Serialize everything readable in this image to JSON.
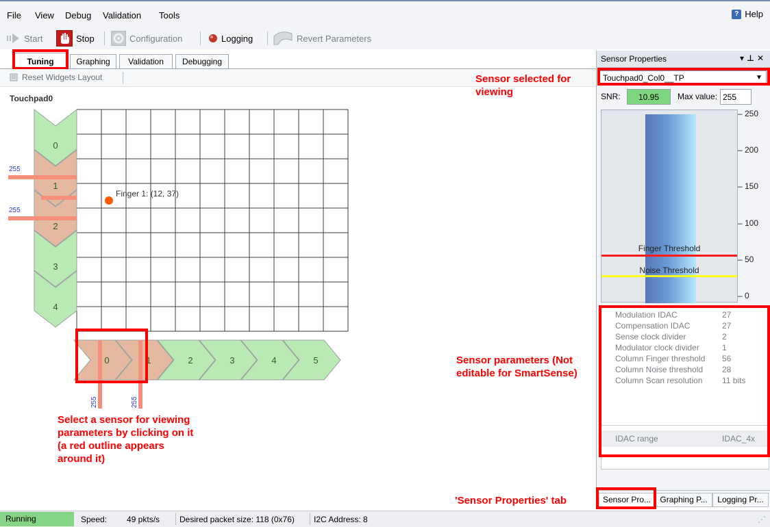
{
  "menu": {
    "items": [
      "File",
      "View",
      "Debug",
      "Validation",
      "Tools"
    ],
    "help": "Help",
    "help_icon": "help-book-icon"
  },
  "toolbar": {
    "start": "Start",
    "stop": "Stop",
    "configuration": "Configuration",
    "logging": "Logging",
    "revert": "Revert Parameters"
  },
  "tabs": [
    "Tuning",
    "Graphing",
    "Validation",
    "Debugging"
  ],
  "active_tab": "Tuning",
  "widgets": {
    "reset_label": "Reset Widgets Layout",
    "widget_title": "Touchpad0"
  },
  "touchpad": {
    "rows": [
      "0",
      "1",
      "2",
      "3",
      "4"
    ],
    "columns": [
      "0",
      "1",
      "2",
      "3",
      "4",
      "5"
    ],
    "finger_label": "Finger 1: (12, 37)",
    "row_values": [
      "255",
      "255"
    ],
    "col_values": [
      "255",
      "255"
    ],
    "colors": {
      "active_sensor": "#e4b9a0",
      "idle_sensor": "#b9eab4",
      "finger": "#ff5a00",
      "signal_bar": "#f58f7c",
      "value_text": "#2a3bd8"
    }
  },
  "annotations": {
    "sensor_selected": "Sensor selected for\nviewing",
    "select_sensor": "Select a sensor for viewing\nparameters by clicking on it\n(a red outline appears\naround it)",
    "sensor_params": "Sensor parameters (Not\neditable for SmartSense)",
    "props_tab": "'Sensor Properties' tab",
    "color": "#ff0000"
  },
  "panel": {
    "title": "Sensor Properties",
    "controls": "▾ ⊓ ✕",
    "selected_sensor": "Touchpad0_Col0__TP",
    "snr_label": "SNR:",
    "snr_value": "10.95",
    "max_label": "Max value:",
    "max_value": "255",
    "bar_level": 1.0,
    "finger_threshold_label": "Finger Threshold",
    "finger_threshold_value": 56,
    "noise_threshold_label": "Noise Threshold",
    "noise_threshold_value": 28,
    "scale": [
      "250",
      "200",
      "150",
      "100",
      "50",
      "0"
    ],
    "properties": [
      {
        "name": "Modulation IDAC",
        "value": "27"
      },
      {
        "name": "Compensation IDAC",
        "value": "27"
      },
      {
        "name": "Sense clock divider",
        "value": "2"
      },
      {
        "name": "Modulator clock divider",
        "value": "1"
      },
      {
        "name": "Column Finger threshold",
        "value": "56"
      },
      {
        "name": "Column Noise threshold",
        "value": "28"
      },
      {
        "name": "Column Scan resolution",
        "value": "11 bits"
      }
    ],
    "idac": {
      "name": "IDAC range",
      "value": "IDAC_4x"
    },
    "bottom_tabs": [
      "Sensor Pro...",
      "Graphing P...",
      "Logging Pr..."
    ]
  },
  "status": {
    "state": "Running",
    "speed_label": "Speed:",
    "speed_value": "49 pkts/s",
    "packet_size": "Desired packet size:  118 (0x76)",
    "i2c": "I2C Address: 8"
  }
}
